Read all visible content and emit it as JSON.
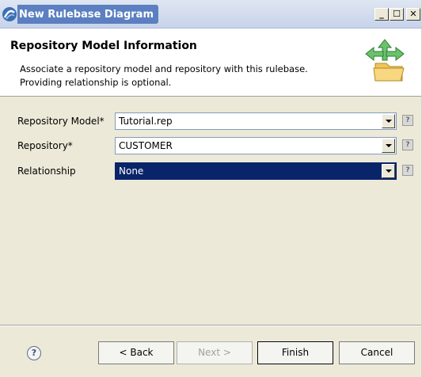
{
  "window": {
    "title": "New Rulebase Diagram",
    "controls": {
      "minimize": "_",
      "maximize": "☐",
      "close": "✕"
    }
  },
  "header": {
    "title": "Repository Model Information",
    "description_line1": "Associate a repository model and repository with this rulebase.",
    "description_line2": "Providing relationship is optional."
  },
  "form": {
    "repository_model": {
      "label": "Repository Model*",
      "value": "Tutorial.rep"
    },
    "repository": {
      "label": "Repository*",
      "value": "CUSTOMER"
    },
    "relationship": {
      "label": "Relationship",
      "value": "None"
    },
    "field_help_glyph": "?"
  },
  "footer": {
    "help_glyph": "?",
    "back_label": "< Back",
    "next_label": "Next >",
    "finish_label": "Finish",
    "cancel_label": "Cancel"
  },
  "colors": {
    "selection": "#0a246a",
    "dialog_face": "#ece9d8",
    "title_gradient_start": "#dfe6f3"
  }
}
